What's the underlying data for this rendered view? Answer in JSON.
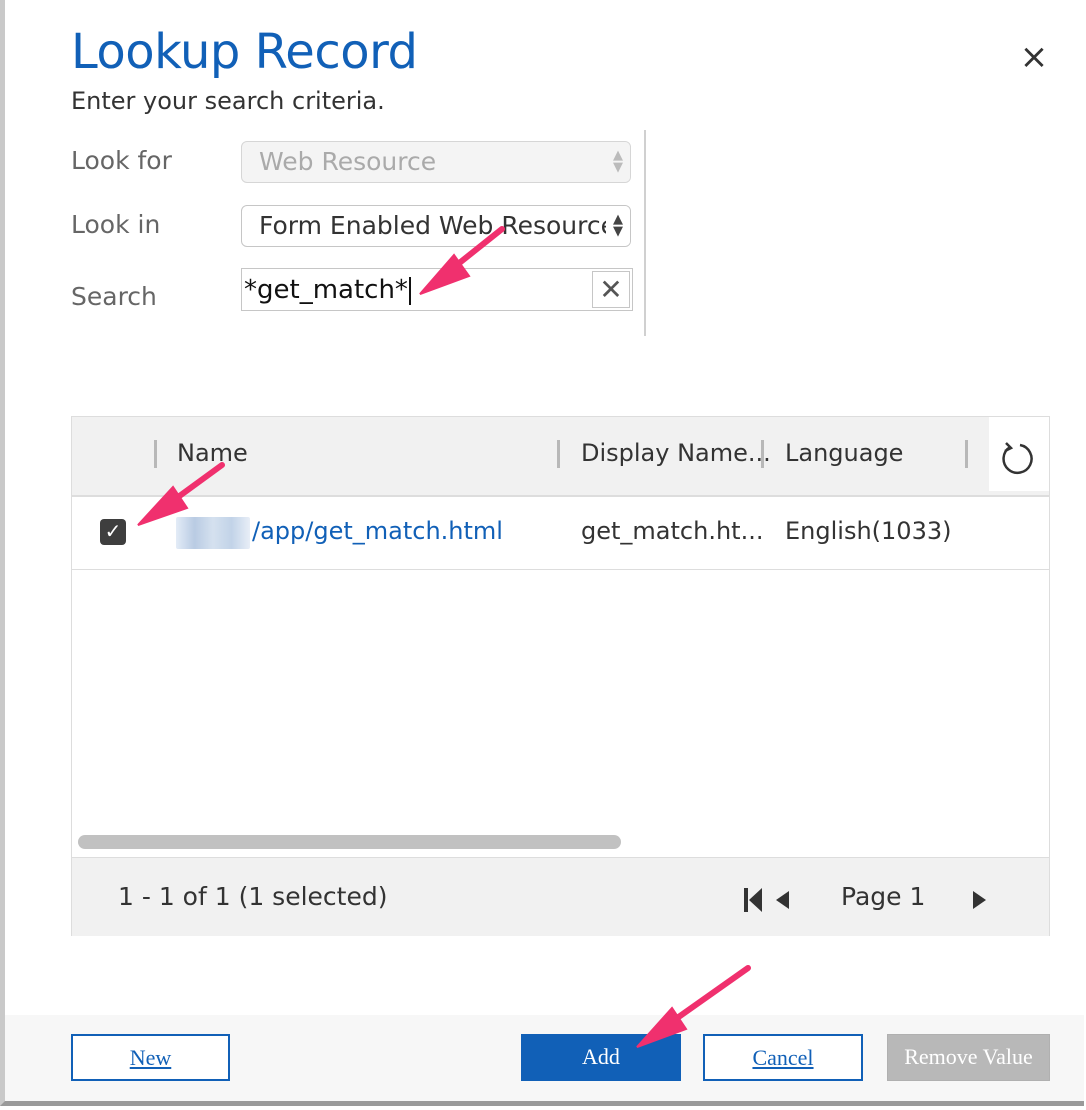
{
  "dialog": {
    "title": "Lookup Record",
    "subtitle": "Enter your search criteria.",
    "close_label": "×"
  },
  "form": {
    "look_for_label": "Look for",
    "look_for_value": "Web Resource",
    "look_in_label": "Look in",
    "look_in_value": "Form Enabled Web Resources",
    "search_label": "Search",
    "search_value": "*get_match*"
  },
  "grid": {
    "columns": [
      "Name",
      "Display Name...",
      "Language"
    ],
    "rows": [
      {
        "selected": true,
        "name": "/app/get_match.html",
        "display_name": "get_match.ht...",
        "language": "English(1033)"
      }
    ],
    "status": "1 - 1 of 1 (1 selected)",
    "page_label": "Page 1"
  },
  "buttons": {
    "new_label": "New",
    "add_label": "Add",
    "cancel_label": "Cancel",
    "remove_label": "Remove Value"
  },
  "colors": {
    "brand": "#1160b7",
    "annotation_arrow": "#f0306e"
  },
  "icons": [
    "close-icon",
    "select-arrows-icon",
    "clear-search-icon",
    "refresh-icon",
    "checkbox-checked-icon",
    "first-page-icon",
    "previous-page-icon",
    "next-page-icon",
    "annotation-arrow"
  ]
}
